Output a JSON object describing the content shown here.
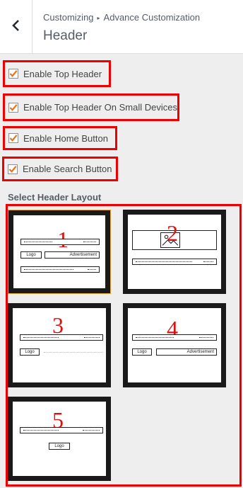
{
  "header": {
    "breadcrumb_parent": "Customizing",
    "breadcrumb_separator": "▸",
    "breadcrumb_current": "Advance Customization",
    "title": "Header"
  },
  "options": [
    {
      "label": "Enable Top Header",
      "checked": true
    },
    {
      "label": "Enable Top Header On Small Devices",
      "checked": true
    },
    {
      "label": "Enable Home Button",
      "checked": true
    },
    {
      "label": "Enable Search Button",
      "checked": true
    }
  ],
  "layout_section": {
    "title": "Select Header Layout",
    "selected": 1,
    "layouts": [
      {
        "number": "1",
        "logo": "Logo",
        "ad": "Advertisement"
      },
      {
        "number": "2"
      },
      {
        "number": "3",
        "logo": "Logo"
      },
      {
        "number": "4",
        "logo": "Logo",
        "ad": "Advertisement"
      },
      {
        "number": "5",
        "logo": "Logo"
      }
    ]
  },
  "colors": {
    "annotation_red": "#ee0000",
    "checkmark_orange": "#e8741a",
    "selected_border": "#e8a43a"
  }
}
